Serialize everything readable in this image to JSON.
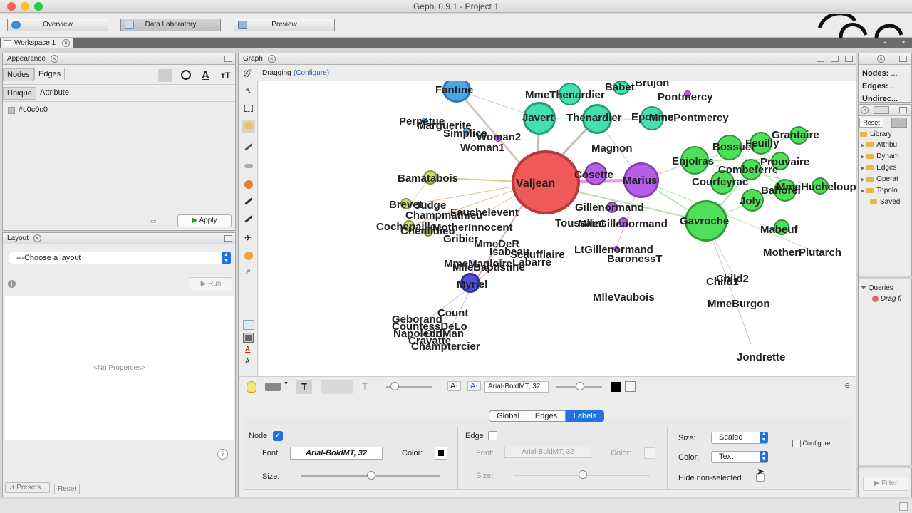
{
  "window": {
    "title": "Gephi 0.9.1 - Project 1"
  },
  "modes": {
    "overview": "Overview",
    "data_lab": "Data Laboratory",
    "preview": "Preview"
  },
  "workspace": {
    "tab": "Workspace 1"
  },
  "appearance": {
    "title": "Appearance",
    "tab_nodes": "Nodes",
    "tab_edges": "Edges",
    "tab_unique": "Unique",
    "tab_attribute": "Attribute",
    "color_value": "#c0c0c0",
    "apply": "Apply"
  },
  "layout_panel": {
    "title": "Layout",
    "choose": "---Choose a layout",
    "run": "Run",
    "no_properties": "<No Properties>",
    "presets": "Presets...",
    "reset": "Reset"
  },
  "graph": {
    "tab": "Graph",
    "mode": "Dragging",
    "configure": "(Configure)",
    "labels": [
      {
        "name": "Fantine"
      },
      {
        "name": "MmeThenardier"
      },
      {
        "name": "Babet"
      },
      {
        "name": "Brujon"
      },
      {
        "name": "Pontmercy"
      },
      {
        "name": "Perpetue"
      },
      {
        "name": "Marguerite"
      },
      {
        "name": "Javert"
      },
      {
        "name": "Thenardier"
      },
      {
        "name": "Eponine"
      },
      {
        "name": "MmePontmercy"
      },
      {
        "name": "Simplice"
      },
      {
        "name": "Woman2"
      },
      {
        "name": "Woman1"
      },
      {
        "name": "Grantaire"
      },
      {
        "name": "Bossuet"
      },
      {
        "name": "Feuilly"
      },
      {
        "name": "Magnon"
      },
      {
        "name": "Enjolras"
      },
      {
        "name": "Prouvaire"
      },
      {
        "name": "Combeferre"
      },
      {
        "name": "Bamatabois"
      },
      {
        "name": "Valjean"
      },
      {
        "name": "Cosette"
      },
      {
        "name": "Marius"
      },
      {
        "name": "Courfeyrac"
      },
      {
        "name": "MmeHucheloup"
      },
      {
        "name": "Bahorel"
      },
      {
        "name": "Brevet"
      },
      {
        "name": "Judge"
      },
      {
        "name": "Joly"
      },
      {
        "name": "Champmathieu"
      },
      {
        "name": "Fauchelevent"
      },
      {
        "name": "Gillenormand"
      },
      {
        "name": "Gavroche"
      },
      {
        "name": "Cochepaille"
      },
      {
        "name": "Toussaint"
      },
      {
        "name": "MlleGillenormand"
      },
      {
        "name": "Chenildieu"
      },
      {
        "name": "MotherInnocent"
      },
      {
        "name": "Mabeuf"
      },
      {
        "name": "Gribier"
      },
      {
        "name": "MmeDeR"
      },
      {
        "name": "LtGillenormand"
      },
      {
        "name": "Isabeau"
      },
      {
        "name": "Scaufflaire"
      },
      {
        "name": "MotherPlutarch"
      },
      {
        "name": "BaronessT"
      },
      {
        "name": "MmeMagloire"
      },
      {
        "name": "Labarre"
      },
      {
        "name": "MlleBaptistine"
      },
      {
        "name": "Myriel"
      },
      {
        "name": "Child2"
      },
      {
        "name": "Child1"
      },
      {
        "name": "MlleVaubois"
      },
      {
        "name": "MmeBurgon"
      },
      {
        "name": "Count"
      },
      {
        "name": "Geborand"
      },
      {
        "name": "CountessDeLo"
      },
      {
        "name": "Napoleon"
      },
      {
        "name": "OldMan"
      },
      {
        "name": "Cravatte"
      },
      {
        "name": "Champtercier"
      },
      {
        "name": "Jondrette"
      }
    ]
  },
  "toolbar": {
    "font": "Arial-BoldMT, 32"
  },
  "labels_panel": {
    "tabs": {
      "global": "Global",
      "edges": "Edges",
      "labels": "Labels"
    },
    "node": {
      "title": "Node",
      "font_label": "Font:",
      "font_value": "Arial-BoldMT, 32",
      "color_label": "Color:",
      "size_label": "Size:"
    },
    "edge": {
      "title": "Edge",
      "font_label": "Font:",
      "font_value": "Arial-BoldMT, 32",
      "color_label": "Color:",
      "size_label": "Size:"
    },
    "right": {
      "size_label": "Size:",
      "size_value": "Scaled",
      "color_label": "Color:",
      "color_value": "Text",
      "hide_label": "Hide non-selected",
      "configure": "Configure..."
    }
  },
  "context": {
    "nodes_label": "Nodes:",
    "nodes_value": "...",
    "edges_label": "Edges:",
    "edges_value": "...",
    "directed": "Undirec..."
  },
  "filters": {
    "reset": "Reset",
    "library": "Library",
    "items": [
      "Attribu",
      "Dynam",
      "Edges",
      "Operat",
      "Topolo",
      "Saved"
    ],
    "queries": "Queries",
    "drag": "Drag fi",
    "filter_btn": "Filter"
  },
  "colors": {
    "accent": "#1e73e0",
    "valjean": "#f05a5a",
    "marius": "#b65ee8",
    "green": "#4ee05a",
    "teal": "#45e0b0"
  }
}
